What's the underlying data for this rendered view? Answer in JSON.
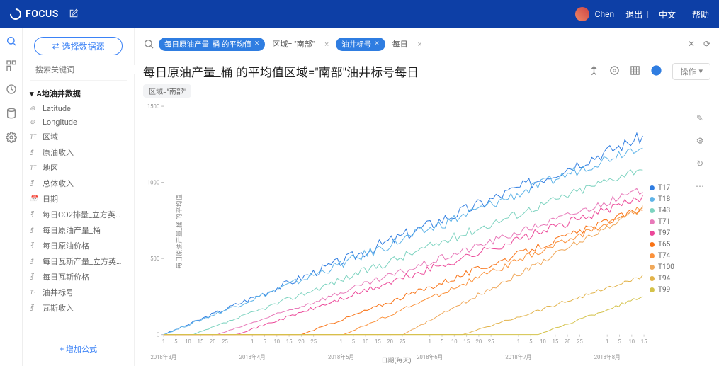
{
  "brand": "FOCUS",
  "user": "Chen",
  "top_links": {
    "logout": "退出",
    "lang": "中文",
    "help": "帮助"
  },
  "select_ds_btn": "选择数据源",
  "search_placeholder": "搜索关键词",
  "ds_name": "A地油井数据",
  "fields": [
    {
      "ic": "⊕",
      "label": "Latitude"
    },
    {
      "ic": "⊕",
      "label": "Longitude"
    },
    {
      "ic": "Tᵀ",
      "label": "区域"
    },
    {
      "ic": "℥",
      "label": "原油收入"
    },
    {
      "ic": "Tᵀ",
      "label": "地区"
    },
    {
      "ic": "℥",
      "label": "总体收入"
    },
    {
      "ic": "📅",
      "label": "日期"
    },
    {
      "ic": "℥",
      "label": "每日CO2排量_立方英…"
    },
    {
      "ic": "℥",
      "label": "每日原油产量_桶"
    },
    {
      "ic": "℥",
      "label": "每日原油价格"
    },
    {
      "ic": "℥",
      "label": "每日瓦斯产量_立方英…"
    },
    {
      "ic": "℥",
      "label": "每日瓦斯价格"
    },
    {
      "ic": "Tᵀ",
      "label": "油井标号"
    },
    {
      "ic": "℥",
      "label": "瓦斯收入"
    }
  ],
  "add_formula": "+ 增加公式",
  "query_chips": [
    {
      "kind": "chip",
      "text": "每日原油产量_桶 的平均值",
      "x": true
    },
    {
      "kind": "plain",
      "text": "区域= \"南部\""
    },
    {
      "kind": "chip",
      "text": "油井标号",
      "x": true
    },
    {
      "kind": "plain",
      "text": "每日"
    }
  ],
  "chart_title": "每日原油产量_桶 的平均值区域=\"南部\"油井标号每日",
  "action_label": "操作",
  "sub_chip": "区域=\"南部\"",
  "chart_data": {
    "type": "line",
    "xlabel": "日期(每天)",
    "ylabel": "每日原油产量_桶 的平均值",
    "ylim": [
      0,
      1500
    ],
    "yticks": [
      0,
      500,
      1000,
      1500
    ],
    "x_range_days": 160,
    "x_month_labels": [
      "2018年3月",
      "2018年4月",
      "2018年5月",
      "2018年6月",
      "2018年7月",
      "2018年8月"
    ],
    "x_minor_ticks": [
      1,
      5,
      10,
      15,
      20,
      25
    ],
    "series": [
      {
        "name": "T17",
        "color": "#2f7de1",
        "start": 0,
        "end": 1300,
        "noise": 80
      },
      {
        "name": "T18",
        "color": "#5fb4e8",
        "start": 0,
        "end": 1250,
        "noise": 70
      },
      {
        "name": "T43",
        "color": "#7dd3c0",
        "start": 0,
        "end": 1100,
        "noise": 60,
        "delay": 10
      },
      {
        "name": "T71",
        "color": "#e879b9",
        "start": 0,
        "end": 950,
        "noise": 50,
        "delay": 18
      },
      {
        "name": "T97",
        "color": "#ec4899",
        "start": 0,
        "end": 900,
        "noise": 55,
        "delay": 24
      },
      {
        "name": "T65",
        "color": "#f97316",
        "start": 0,
        "end": 830,
        "noise": 45,
        "delay": 46
      },
      {
        "name": "T74",
        "color": "#fb923c",
        "start": 0,
        "end": 830,
        "noise": 45,
        "delay": 60
      },
      {
        "name": "T100",
        "color": "#f0a85a",
        "start": 0,
        "end": 830,
        "noise": 40,
        "delay": 80
      },
      {
        "name": "T94",
        "color": "#e2b34a",
        "start": 0,
        "end": 380,
        "noise": 25,
        "delay": 100
      },
      {
        "name": "T99",
        "color": "#d4c24a",
        "start": 0,
        "end": 250,
        "noise": 20,
        "delay": 125
      }
    ]
  }
}
